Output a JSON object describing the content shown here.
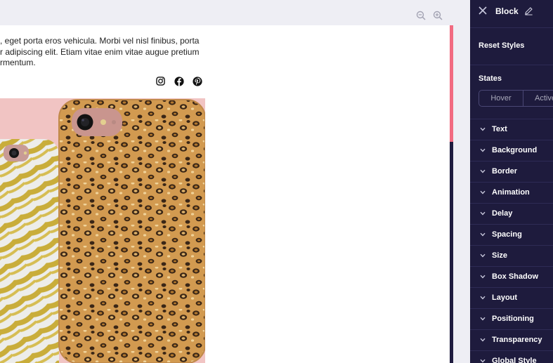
{
  "canvas": {
    "zoom_out_icon": "zoom-out-icon",
    "zoom_in_icon": "zoom-in-icon",
    "paragraph_lines": [
      ", eget porta eros vehicula. Morbi vel nisl finibus, porta",
      "r adipiscing elit. Etiam vitae enim vitae augue pretium",
      "rmentum."
    ],
    "social_icons": [
      "instagram-icon",
      "facebook-icon",
      "pinterest-icon"
    ],
    "product_image": "phone-cases-zebra-and-leopard",
    "scrollbar_color": "#f26b81"
  },
  "panel": {
    "title": "Block",
    "reset_label": "Reset Styles",
    "states_label": "States",
    "states": [
      "Hover",
      "Active"
    ],
    "sections": [
      "Text",
      "Background",
      "Border",
      "Animation",
      "Delay",
      "Spacing",
      "Size",
      "Box Shadow",
      "Layout",
      "Positioning",
      "Transparency",
      "Global Style"
    ],
    "bg_color": "#1e1b3d"
  }
}
